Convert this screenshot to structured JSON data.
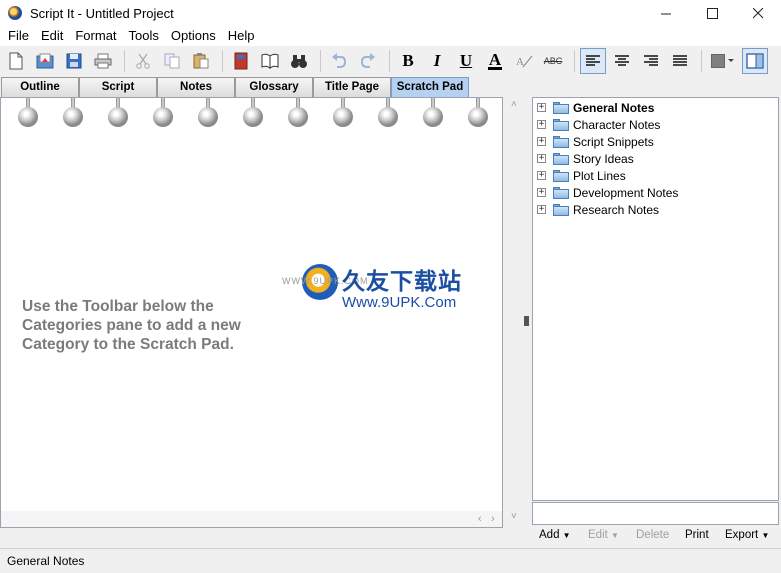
{
  "window": {
    "title": "Script It - Untitled Project",
    "controls": [
      "minimize",
      "maximize",
      "close"
    ]
  },
  "menu": [
    "File",
    "Edit",
    "Format",
    "Tools",
    "Options",
    "Help"
  ],
  "toolbar": {
    "bold_label": "B",
    "italic_label": "I",
    "underline_label": "U",
    "font_color_label": "A",
    "spell_label": "ABC",
    "colors": {
      "accent": "#b6d0f2",
      "swatch": "#808080"
    }
  },
  "tabs": [
    {
      "label": "Outline",
      "active": false
    },
    {
      "label": "Script",
      "active": false
    },
    {
      "label": "Notes",
      "active": false
    },
    {
      "label": "Glossary",
      "active": false
    },
    {
      "label": "Title Page",
      "active": false
    },
    {
      "label": "Scratch Pad",
      "active": true
    }
  ],
  "scratch_pad": {
    "message": "Use the Toolbar below the Categories pane to add a new Category to the Scratch Pad."
  },
  "categories": [
    {
      "label": "General Notes",
      "bold": true
    },
    {
      "label": "Character Notes",
      "bold": false
    },
    {
      "label": "Script Snippets",
      "bold": false
    },
    {
      "label": "Story Ideas",
      "bold": false
    },
    {
      "label": "Plot Lines",
      "bold": false
    },
    {
      "label": "Development Notes",
      "bold": false
    },
    {
      "label": "Research Notes",
      "bold": false
    }
  ],
  "category_actions": {
    "add": "Add",
    "edit": "Edit",
    "delete": "Delete",
    "print": "Print",
    "export": "Export"
  },
  "status": {
    "text": "General Notes"
  },
  "watermark": {
    "title": "久友下载站",
    "url": "Www.9UPK.Com",
    "small": "WWW.9UPK.COM"
  }
}
